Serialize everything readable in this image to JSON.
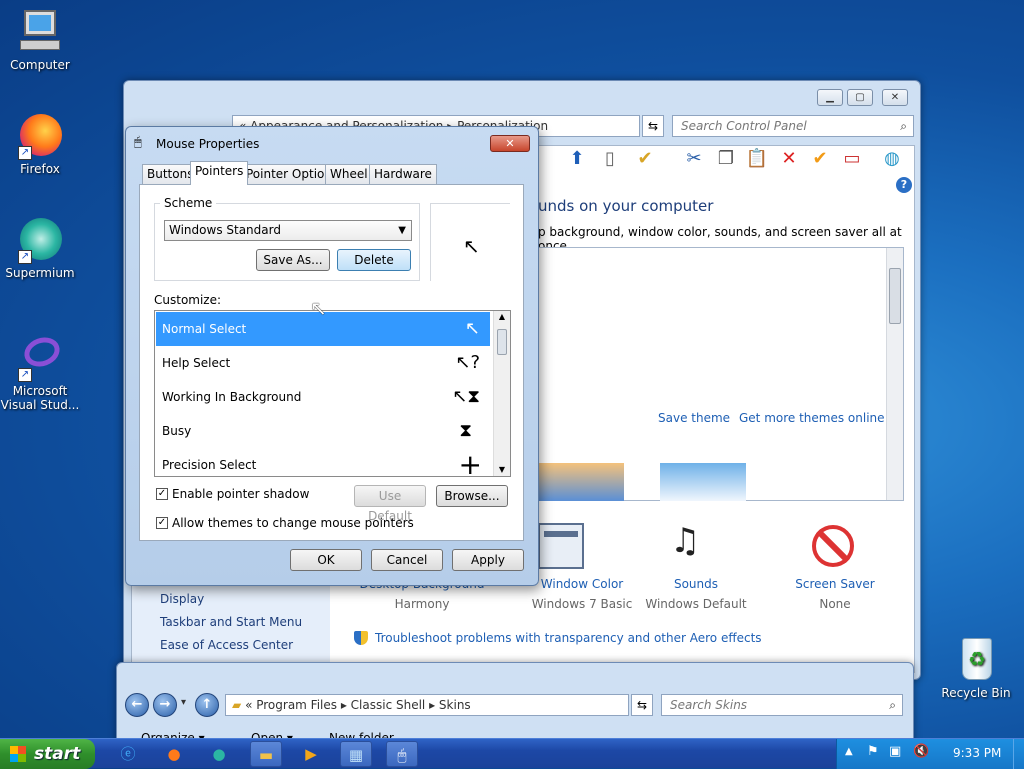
{
  "desktop": {
    "icons": [
      {
        "label": "Computer"
      },
      {
        "label": "Firefox"
      },
      {
        "label": "Supermium"
      },
      {
        "label": "Microsoft Visual Stud..."
      },
      {
        "label": "Recycle Bin"
      }
    ]
  },
  "cp": {
    "address": {
      "chevron": "«",
      "parts": [
        "Appearance and Personalization",
        "Personalization"
      ]
    },
    "search_placeholder": "Search Control Panel",
    "heading": "unds on your computer",
    "subtitle": "p background, window color, sounds, and screen saver all at once.",
    "save_theme": "Save theme",
    "more_themes": "Get more themes online",
    "sidebar": [
      "Display",
      "Taskbar and Start Menu",
      "Ease of Access Center"
    ],
    "options": [
      {
        "label": "Desktop Background",
        "value": "Harmony"
      },
      {
        "label": "Window Color",
        "value": "Windows 7 Basic"
      },
      {
        "label": "Sounds",
        "value": "Windows Default"
      },
      {
        "label": "Screen Saver",
        "value": "None"
      }
    ],
    "troubleshoot": "Troubleshoot problems with transparency and other Aero effects",
    "help": "?"
  },
  "skins": {
    "address_parts": [
      "«",
      "Program Files",
      "Classic Shell",
      "Skins"
    ],
    "search_placeholder": "Search Skins",
    "toolbar": {
      "organize": "Organize ▾",
      "open": "Open ▾",
      "new_folder": "New folder"
    }
  },
  "dialog": {
    "title": "Mouse Properties",
    "tabs": [
      "Buttons",
      "Pointers",
      "Pointer Options",
      "Wheel",
      "Hardware"
    ],
    "scheme_label": "Scheme",
    "scheme_value": "Windows Standard",
    "save_as": "Save As...",
    "delete": "Delete",
    "customize_label": "Customize:",
    "pointers": [
      {
        "name": "Normal Select",
        "cursor": "↖"
      },
      {
        "name": "Help Select",
        "cursor": "↖?"
      },
      {
        "name": "Working In Background",
        "cursor": "↖⧗"
      },
      {
        "name": "Busy",
        "cursor": "⧗"
      },
      {
        "name": "Precision Select",
        "cursor": "+"
      }
    ],
    "shadow_label": "Enable pointer shadow",
    "themes_label": "Allow themes to change mouse pointers",
    "use_default": "Use Default",
    "browse": "Browse...",
    "ok": "OK",
    "cancel": "Cancel",
    "apply": "Apply"
  },
  "taskbar": {
    "start": "start",
    "time": "9:33 PM"
  }
}
